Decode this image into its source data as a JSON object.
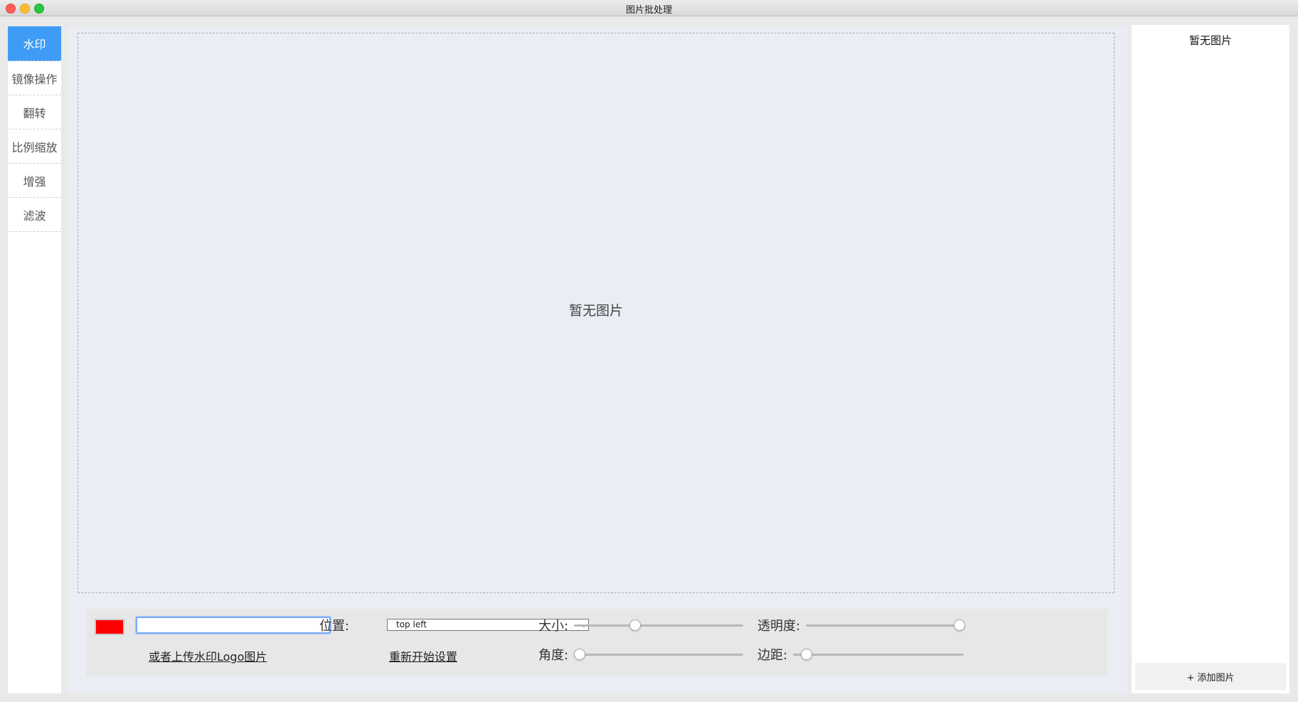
{
  "window": {
    "title": "图片批处理"
  },
  "nav": {
    "items": [
      {
        "label": "水印",
        "active": true
      },
      {
        "label": "镜像操作"
      },
      {
        "label": "翻转"
      },
      {
        "label": "比例缩放"
      },
      {
        "label": "增强"
      },
      {
        "label": "滤波"
      }
    ]
  },
  "preview": {
    "empty_text": "暂无图片"
  },
  "controls": {
    "color": "#ff0000",
    "text_value": "",
    "position_label": "位置:",
    "position_value": "top left",
    "size_label": "大小:",
    "size_level": 0.35,
    "opacity_label": "透明度:",
    "opacity_level": 1.0,
    "upload_link": "或者上传水印Logo图片",
    "reset_link": "重新开始设置",
    "angle_label": "角度:",
    "angle_level": 0.0,
    "margin_label": "边距:",
    "margin_level": 0.05
  },
  "right": {
    "title": "暂无图片",
    "add_button": "+ 添加图片"
  }
}
